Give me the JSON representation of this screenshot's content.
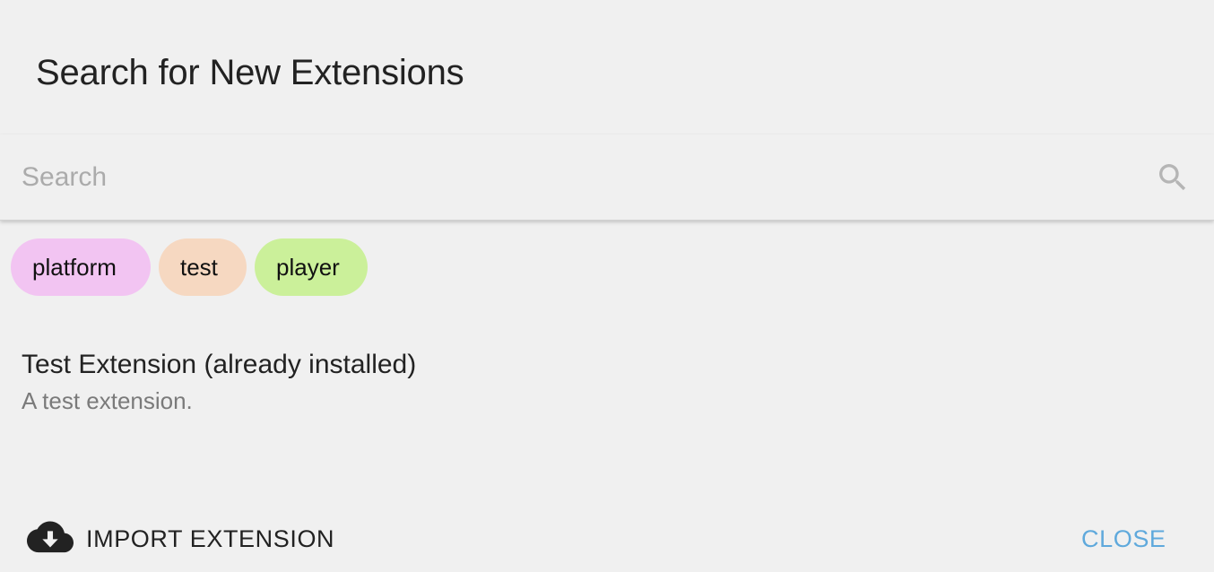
{
  "dialog": {
    "title": "Search for New Extensions"
  },
  "search": {
    "placeholder": "Search",
    "value": "",
    "icon": "search-icon"
  },
  "tags": [
    {
      "label": "platform",
      "color": "#f2c4f2"
    },
    {
      "label": "test",
      "color": "#f6d8c1"
    },
    {
      "label": "player",
      "color": "#cbf09a"
    }
  ],
  "results": [
    {
      "title": "Test Extension (already installed)",
      "description": "A test extension."
    }
  ],
  "footer": {
    "import_label": "IMPORT EXTENSION",
    "import_icon": "cloud-download-icon",
    "close_label": "CLOSE",
    "close_color": "#5fa9dc"
  }
}
